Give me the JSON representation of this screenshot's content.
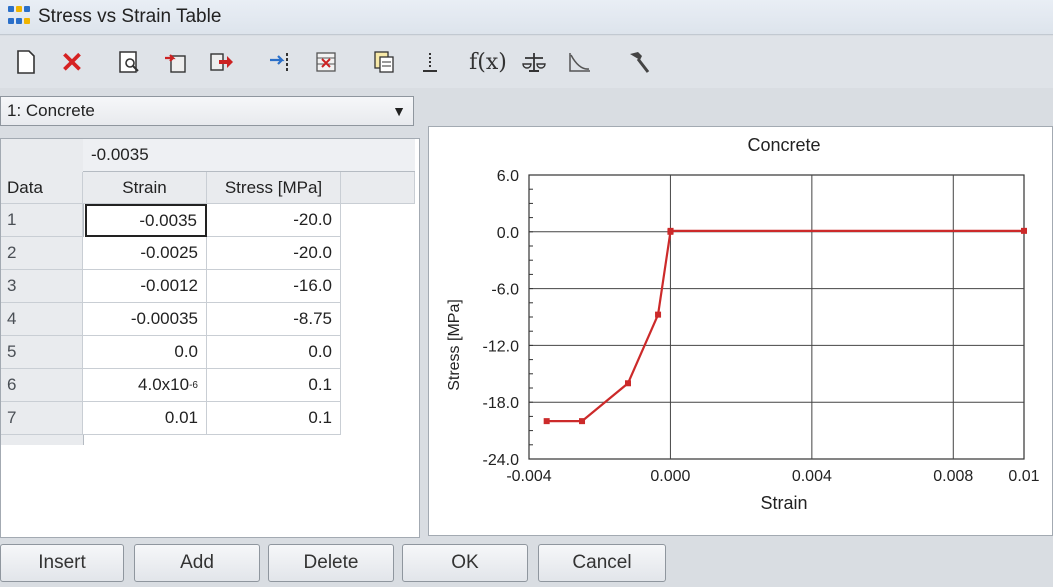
{
  "window": {
    "title": "Stress vs Strain Table"
  },
  "toolbar": {
    "items": [
      {
        "icon": "new-page-icon"
      },
      {
        "icon": "close-icon"
      },
      {
        "icon": "preview-icon"
      },
      {
        "icon": "import-icon"
      },
      {
        "icon": "export-icon"
      },
      {
        "icon": "insert-column-icon"
      },
      {
        "icon": "delete-table-icon"
      },
      {
        "icon": "copy-data-icon"
      },
      {
        "icon": "sort-icon"
      },
      {
        "icon": "function-icon",
        "label": "f(x)"
      },
      {
        "icon": "balance-icon"
      },
      {
        "icon": "curve-icon"
      },
      {
        "icon": "hammer-icon"
      }
    ]
  },
  "material_select": {
    "value": "1: Concrete"
  },
  "table": {
    "edit_value": "-0.0035",
    "data_header": "Data",
    "columns": [
      "Strain",
      "Stress [MPa]"
    ],
    "rows": [
      {
        "index": "1",
        "strain": "-0.0035",
        "stress": "-20.0"
      },
      {
        "index": "2",
        "strain": "-0.0025",
        "stress": "-20.0"
      },
      {
        "index": "3",
        "strain": "-0.0012",
        "stress": "-16.0"
      },
      {
        "index": "4",
        "strain": "-0.00035",
        "stress": "-8.75"
      },
      {
        "index": "5",
        "strain": "0.0",
        "stress": "0.0"
      },
      {
        "index": "6",
        "strain_base": "4.0x10",
        "strain_exp": "-6",
        "stress": "0.1"
      },
      {
        "index": "7",
        "strain": "0.01",
        "stress": "0.1"
      }
    ]
  },
  "chart_data": {
    "type": "line",
    "title": "Concrete",
    "xlabel": "Strain",
    "ylabel": "Stress [MPa]",
    "xlim": [
      -0.004,
      0.01
    ],
    "ylim": [
      -24.0,
      6.0
    ],
    "x_ticks": [
      "-0.004",
      "0.000",
      "0.004",
      "0.008",
      "0.01"
    ],
    "y_ticks": [
      "6.0",
      "0.0",
      "-6.0",
      "-12.0",
      "-18.0",
      "-24.0"
    ],
    "grid": true,
    "series": [
      {
        "color": "#cc2a2a",
        "x": [
          -0.0035,
          -0.0025,
          -0.0012,
          -0.00035,
          0.0,
          4e-06,
          0.01
        ],
        "y": [
          -20.0,
          -20.0,
          -16.0,
          -8.75,
          0.0,
          0.1,
          0.1
        ]
      }
    ]
  },
  "buttons": {
    "insert": "Insert",
    "add": "Add",
    "delete": "Delete",
    "ok": "OK",
    "cancel": "Cancel"
  }
}
